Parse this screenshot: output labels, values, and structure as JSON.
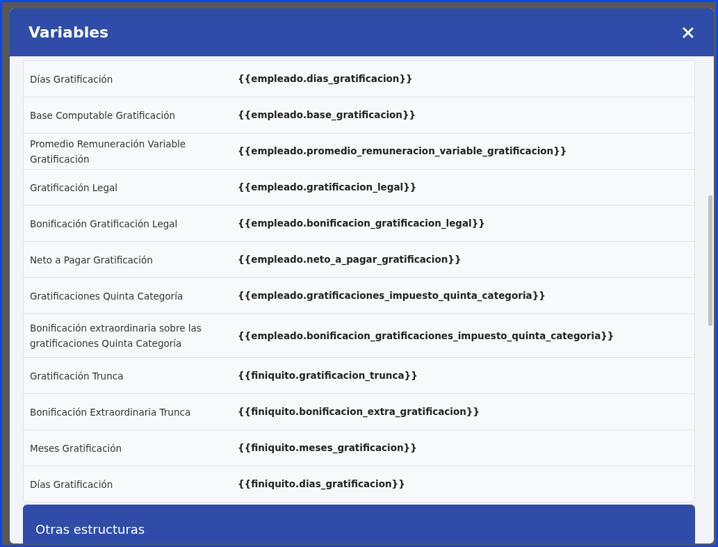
{
  "modal": {
    "title": "Variables"
  },
  "rows": [
    {
      "label": "Días Gratificación",
      "variable": "{{empleado.dias_gratificacion}}"
    },
    {
      "label": "Base Computable Gratificación",
      "variable": "{{empleado.base_gratificacion}}"
    },
    {
      "label": "Promedio Remuneración Variable Gratificación",
      "variable": "{{empleado.promedio_remuneracion_variable_gratificacion}}"
    },
    {
      "label": "Gratificación Legal",
      "variable": "{{empleado.gratificacion_legal}}"
    },
    {
      "label": "Bonificación Gratificación Legal",
      "variable": "{{empleado.bonificacion_gratificacion_legal}}"
    },
    {
      "label": "Neto a Pagar Gratificación",
      "variable": "{{empleado.neto_a_pagar_gratificacion}}"
    },
    {
      "label": "Gratificaciones Quinta Categoría",
      "variable": "{{empleado.gratificaciones_impuesto_quinta_categoria}}"
    },
    {
      "label": "Bonificación extraordinaria sobre las gratificaciones Quinta Categoría",
      "variable": "{{empleado.bonificacion_gratificaciones_impuesto_quinta_categoria}}"
    },
    {
      "label": "Gratificación Trunca",
      "variable": "{{finiquito.gratificacion_trunca}}"
    },
    {
      "label": "Bonificación Extraordinaria Trunca",
      "variable": "{{finiquito.bonificacion_extra_gratificacion}}"
    },
    {
      "label": "Meses Gratificación",
      "variable": "{{finiquito.meses_gratificacion}}"
    },
    {
      "label": "Días Gratificación",
      "variable": "{{finiquito.dias_gratificacion}}"
    }
  ],
  "next_section": {
    "title": "Otras estructuras"
  }
}
